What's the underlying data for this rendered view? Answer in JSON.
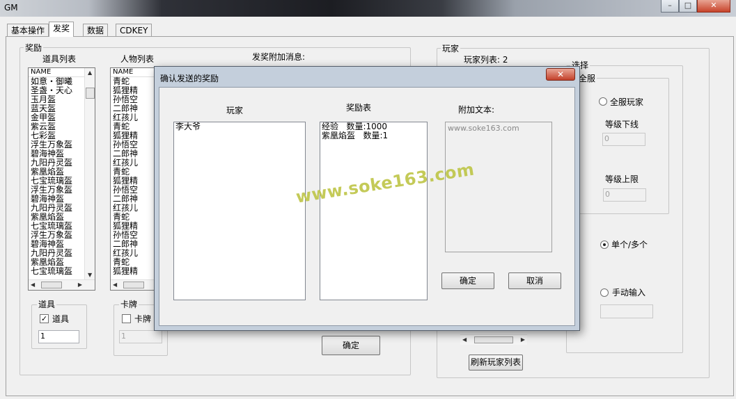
{
  "window": {
    "title": "GM"
  },
  "tabs": [
    "基本操作",
    "发奖",
    "数据",
    "CDKEY"
  ],
  "reward_group": {
    "label": "奖励",
    "item_list_label": "道具列表",
    "char_list_label": "人物列表",
    "extra_msg_label": "发奖附加消息:",
    "list_header": "NAME",
    "items": [
      "如意・御曦",
      "圣盏・天心",
      "玉月盔",
      "蓝天盔",
      "金甲盔",
      "紫云盔",
      "七彩盔",
      "浮生万象盔",
      "碧海神盔",
      "九阳丹灵盔",
      "紫凰焰盔",
      "七宝琉璃盔",
      "浮生万象盔",
      "碧海神盔",
      "九阳丹灵盔",
      "紫凰焰盔",
      "七宝琉璃盔",
      "浮生万象盔",
      "碧海神盔",
      "九阳丹灵盔",
      "紫凰焰盔",
      "七宝琉璃盔"
    ],
    "characters": [
      "青蛇",
      "狐狸精",
      "孙悟空",
      "二郎神",
      "红孩儿",
      "青蛇",
      "狐狸精",
      "孙悟空",
      "二郎神",
      "红孩儿",
      "青蛇",
      "狐狸精",
      "孙悟空",
      "二郎神",
      "红孩儿",
      "青蛇",
      "狐狸精",
      "孙悟空",
      "二郎神",
      "红孩儿",
      "青蛇",
      "狐狸精"
    ],
    "item_group_label": "道具",
    "item_checkbox_label": "道具",
    "item_checked": true,
    "item_qty": "1",
    "card_group_label": "卡牌",
    "card_checkbox_label": "卡牌",
    "card_checked": false,
    "card_qty": "1",
    "confirm_label": "确定"
  },
  "player_group": {
    "label": "玩家",
    "player_list_label": "玩家列表: 2",
    "select_label": "选择",
    "all_server_label": "全服",
    "all_players_label": "全服玩家",
    "level_low_label": "等级下线",
    "level_low_value": "0",
    "level_high_label": "等级上限",
    "level_high_value": "0",
    "single_multi_label": "单个/多个",
    "manual_label": "手动输入",
    "manual_value": "",
    "refresh_label": "刷新玩家列表",
    "selected_mode": "single_multi"
  },
  "dialog": {
    "title": "确认发送的奖励",
    "close_glyph": "✕",
    "player_col": "玩家",
    "reward_col": "奖励表",
    "text_col": "附加文本:",
    "players": [
      "李大爷"
    ],
    "rewards": [
      "经验   数量:1000",
      "紫凰焰盔   数量:1"
    ],
    "extra_text": "www.soke163.com",
    "ok_label": "确定",
    "cancel_label": "取消"
  },
  "watermark": "www.soke163.com"
}
